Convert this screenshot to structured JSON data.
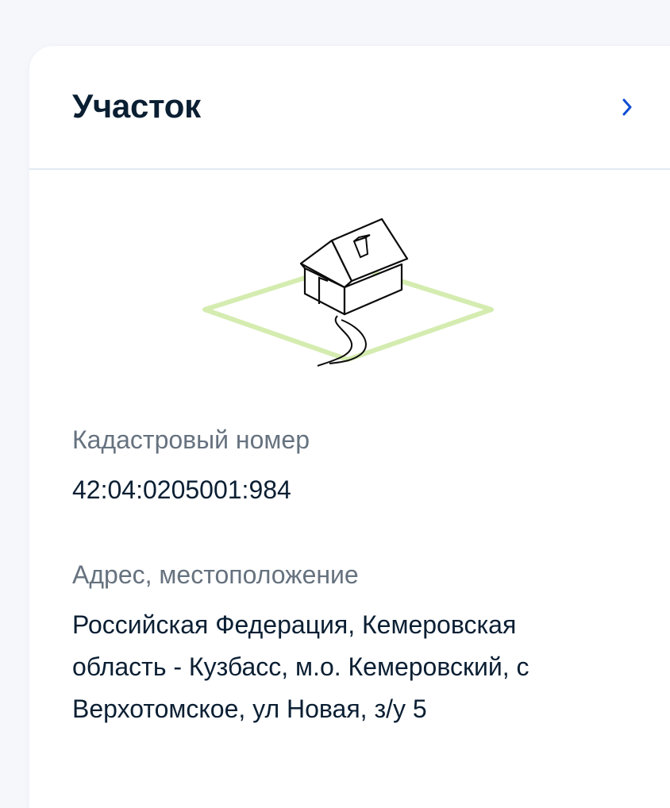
{
  "card": {
    "title": "Участок",
    "chevron_icon": "chevron-right-icon",
    "illustration_icon": "house-plot-icon"
  },
  "fields": {
    "cadastral_label": "Кадастровый номер",
    "cadastral_value": "42:04:0205001:984",
    "address_label": "Адрес, местоположение",
    "address_line_1": "Российская Федерация, Кемеровская",
    "address_line_2": "область - Кузбасс, м.о. Кемеровский, с",
    "address_line_3": "Верхотомское, ул Новая, з/у 5"
  },
  "colors": {
    "title": "#0b1f33",
    "label": "#66727f",
    "accent": "#0d4cd3",
    "plot_green": "#cfe8a6"
  }
}
